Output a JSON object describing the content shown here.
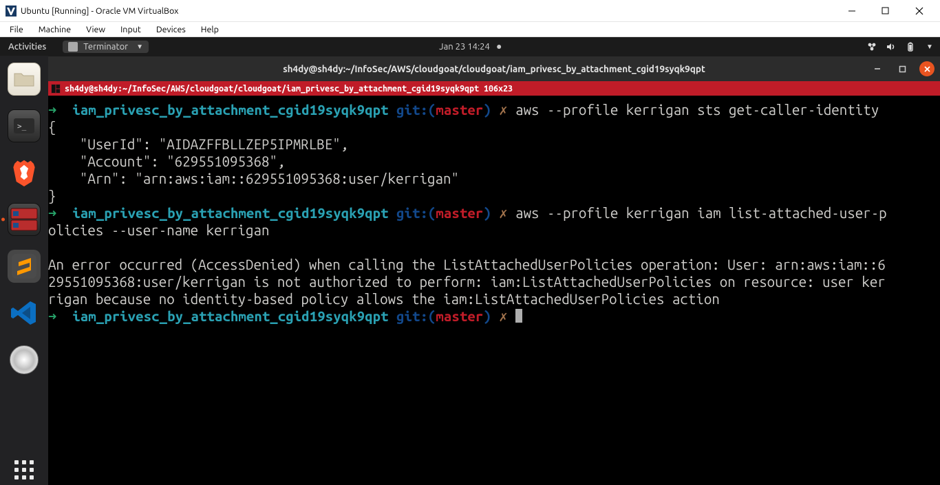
{
  "win": {
    "title": "Ubuntu [Running] - Oracle VM VirtualBox",
    "menu": [
      "File",
      "Machine",
      "View",
      "Input",
      "Devices",
      "Help"
    ]
  },
  "gnome": {
    "activities": "Activities",
    "app_name": "Terminator",
    "datetime": "Jan 23  14:24"
  },
  "terminal": {
    "title": "sh4dy@sh4dy:~/InfoSec/AWS/cloudgoat/cloudgoat/iam_privesc_by_attachment_cgid19syqk9qpt",
    "subbar": "sh4dy@sh4dy:~/InfoSec/AWS/cloudgoat/cloudgoat/iam_privesc_by_attachment_cgid19syqk9qpt 106x23",
    "prompt": {
      "arrow": "➜",
      "dir": "iam_privesc_by_attachment_cgid19syqk9qpt",
      "git_label": "git:(",
      "branch": "master",
      "git_close": ")",
      "lightning": "✗"
    },
    "cmd1": "aws --profile kerrigan sts get-caller-identity",
    "out1_l1": "{",
    "out1_l2": "    \"UserId\": \"AIDAZFFBLLZEP5IPMRLBE\",",
    "out1_l3": "    \"Account\": \"629551095368\",",
    "out1_l4": "    \"Arn\": \"arn:aws:iam::629551095368:user/kerrigan\"",
    "out1_l5": "}",
    "cmd2a": "aws --profile kerrigan iam list-attached-user-p",
    "cmd2b": "olicies --user-name kerrigan",
    "blank": "",
    "err_l1": "An error occurred (AccessDenied) when calling the ListAttachedUserPolicies operation: User: arn:aws:iam::6",
    "err_l2": "29551095368:user/kerrigan is not authorized to perform: iam:ListAttachedUserPolicies on resource: user ker",
    "err_l3": "rigan because no identity-based policy allows the iam:ListAttachedUserPolicies action"
  }
}
